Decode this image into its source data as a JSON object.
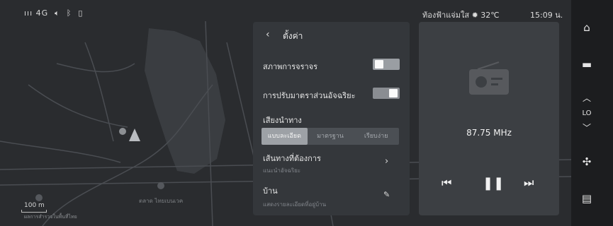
{
  "status_bar": {
    "signal": "ııı 4G",
    "volume_icon": "speaker-icon",
    "bluetooth_icon": "bluetooth-icon",
    "phone_icon": "phone-icon",
    "weather_text": "ท้องฟ้าแจ่มใส",
    "weather_icon": "sun-icon",
    "temperature": "32℃",
    "time": "15:09 น."
  },
  "map": {
    "labels": [
      "ตลาด ไทยเบนเวค"
    ],
    "scale": "100 m",
    "scale_sub": "ผลการสำรวจในพื้นที่ไทย"
  },
  "settings": {
    "back_icon": "chevron-left-icon",
    "title": "ตั้งค่า",
    "traffic": {
      "label": "สภาพการจราจร",
      "on": false
    },
    "smart_scale": {
      "label": "การปรับมาตราส่วนอัจฉริยะ",
      "on": true
    },
    "voice_guidance": {
      "label": "เสียงนำทาง",
      "options": [
        "แบบละเอียด",
        "มาตรฐาน",
        "เรียบง่าย"
      ],
      "selected": "แบบละเอียด"
    },
    "route_pref": {
      "label": "เส้นทางที่ต้องการ",
      "sub": "แนะนำอัจฉริยะ"
    },
    "home": {
      "label": "บ้าน",
      "sub": "แสดงรายละเอียดที่อยู่บ้าน"
    }
  },
  "radio": {
    "icon": "radio-icon",
    "frequency": "87.75 MHz",
    "prev_icon": "skip-previous-icon",
    "pause_icon": "pause-icon",
    "next_icon": "skip-next-icon"
  },
  "rail": {
    "home_icon": "home-icon",
    "media_icon": "media-icon",
    "temp_label": "LO",
    "fan_icon": "fan-icon",
    "phone_icon": "phone-app-icon"
  }
}
